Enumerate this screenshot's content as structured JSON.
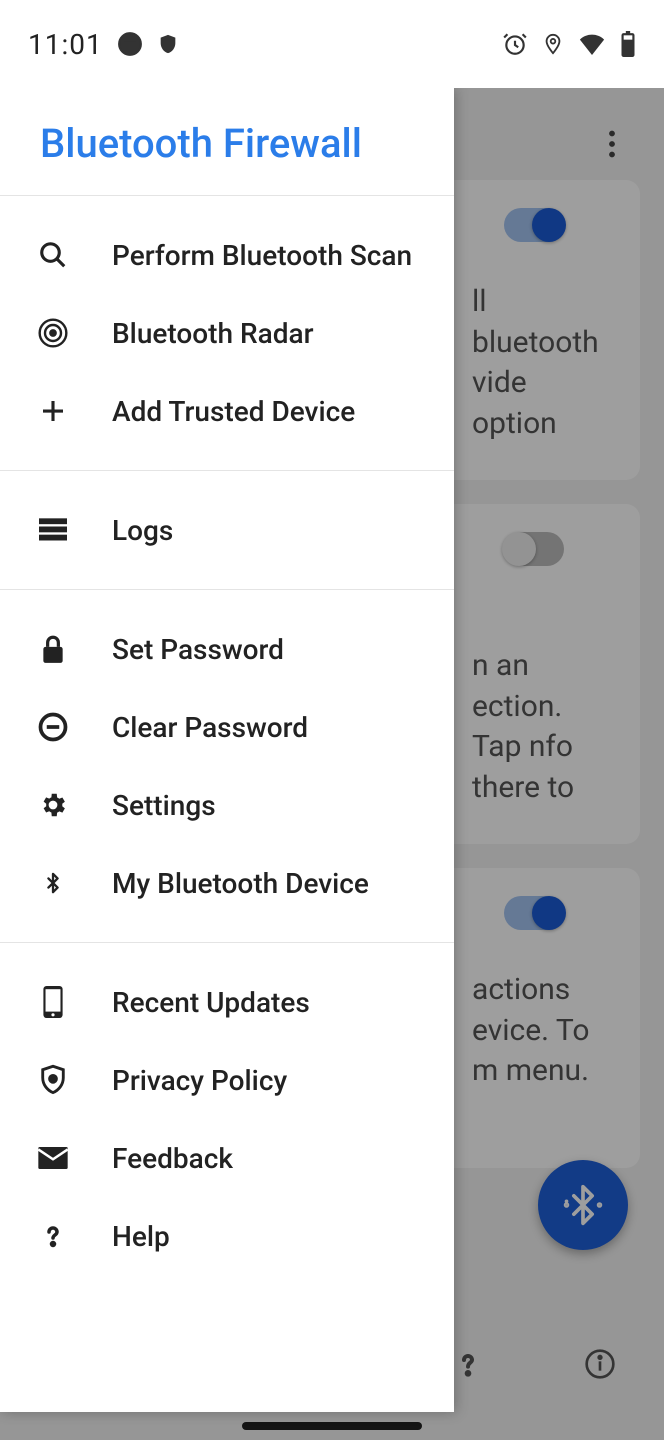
{
  "status": {
    "time": "11:01"
  },
  "drawer": {
    "title": "Bluetooth Firewall",
    "items": {
      "scan": "Perform Bluetooth Scan",
      "radar": "Bluetooth Radar",
      "add_trusted": "Add Trusted Device",
      "logs": "Logs",
      "set_password": "Set Password",
      "clear_password": "Clear Password",
      "settings": "Settings",
      "my_device": "My Bluetooth Device",
      "recent_updates": "Recent Updates",
      "privacy": "Privacy Policy",
      "feedback": "Feedback",
      "help": "Help"
    }
  },
  "main": {
    "card1_text": "ll bluetooth vide option",
    "card1_toggle": true,
    "card2_text": "n an ection. Tap nfo there to",
    "card2_toggle": false,
    "card3_text": "actions evice. To m menu.",
    "card3_toggle": true
  }
}
